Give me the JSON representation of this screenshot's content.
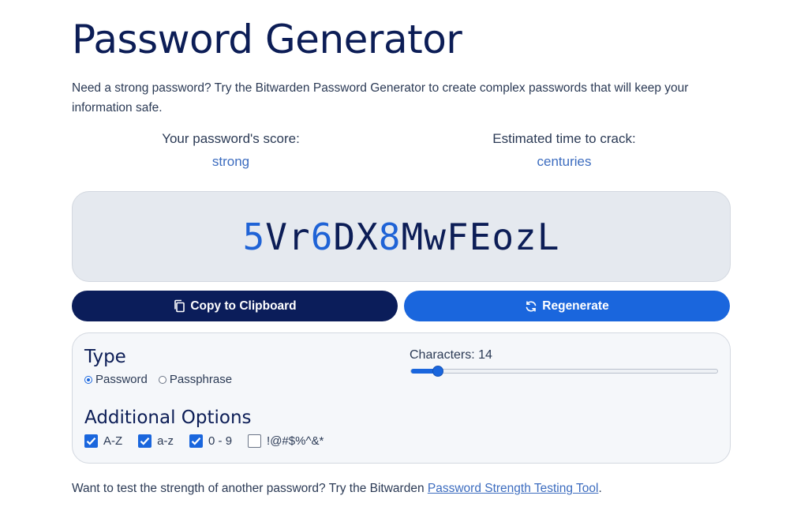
{
  "page": {
    "title": "Password Generator",
    "intro": "Need a strong password? Try the Bitwarden Password Generator to create complex passwords that will keep your information safe."
  },
  "score": {
    "label": "Your password's score:",
    "value": "strong"
  },
  "crack_time": {
    "label": "Estimated time to crack:",
    "value": "centuries"
  },
  "password": {
    "value": "5Vr6DX8MwFEozL",
    "number_color": "#1f63d6",
    "letter_color": "#0c1d56"
  },
  "buttons": {
    "copy": {
      "label": "Copy to Clipboard",
      "icon": "copy-icon"
    },
    "regenerate": {
      "label": "Regenerate",
      "icon": "refresh-icon"
    }
  },
  "type": {
    "heading": "Type",
    "options": [
      {
        "label": "Password",
        "selected": true
      },
      {
        "label": "Passphrase",
        "selected": false
      }
    ]
  },
  "characters": {
    "label": "Characters: 14",
    "value": 14,
    "min": 5,
    "max": 128
  },
  "additional_options": {
    "heading": "Additional Options",
    "items": [
      {
        "label": "A-Z",
        "checked": true
      },
      {
        "label": "a-z",
        "checked": true
      },
      {
        "label": "0 - 9",
        "checked": true
      },
      {
        "label": "!@#$%^&*",
        "checked": false
      }
    ]
  },
  "footer": {
    "text": "Want to test the strength of another password? Try the Bitwarden ",
    "link": "Password Strength Testing Tool",
    "end": "."
  },
  "colors": {
    "primary_dark": "#0b1d5a",
    "primary_blue": "#1a66dd",
    "accent_text": "#3c6cbf"
  }
}
